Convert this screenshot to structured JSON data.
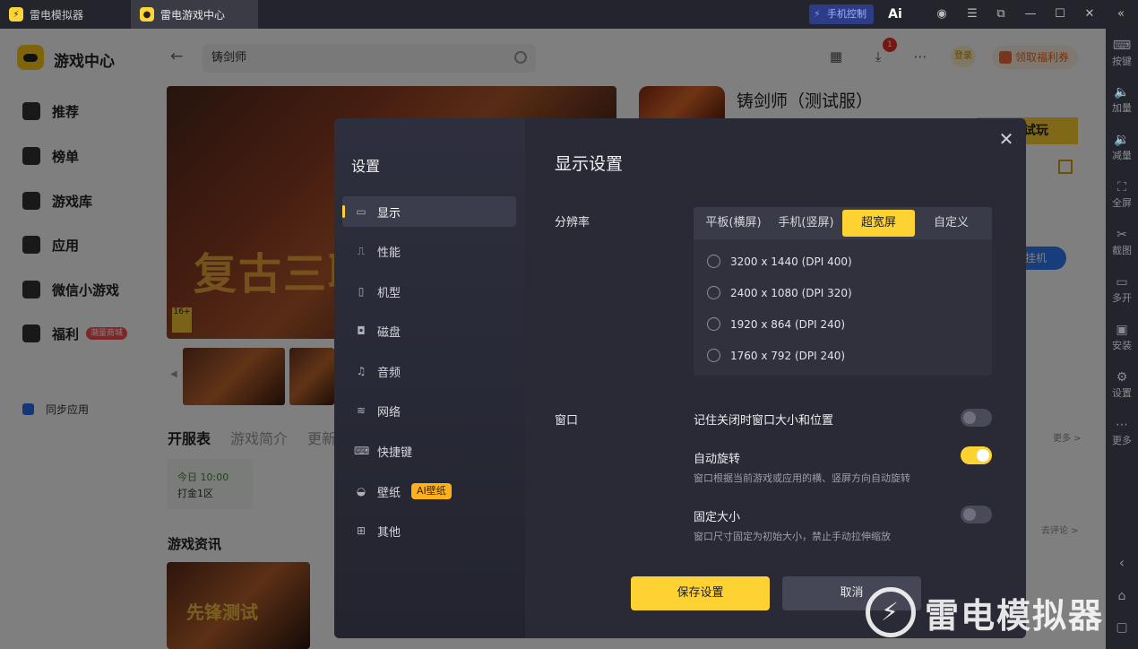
{
  "titlebar": {
    "tabs": [
      {
        "label": "雷电模拟器"
      },
      {
        "label": "雷电游戏中心"
      }
    ],
    "phone_control": "手机控制",
    "ai_label": "Ai"
  },
  "right_sidebar": {
    "items": [
      {
        "label": "按键",
        "icon": "keyboard-icon"
      },
      {
        "label": "加量",
        "icon": "volume-up-icon"
      },
      {
        "label": "减量",
        "icon": "volume-down-icon"
      },
      {
        "label": "全屏",
        "icon": "fullscreen-icon"
      },
      {
        "label": "截图",
        "icon": "screenshot-icon"
      },
      {
        "label": "多开",
        "icon": "multi-open-icon"
      },
      {
        "label": "安装",
        "icon": "install-icon"
      },
      {
        "label": "设置",
        "icon": "settings-icon"
      },
      {
        "label": "更多",
        "icon": "more-icon"
      }
    ]
  },
  "header": {
    "title": "游戏中心",
    "search_value": "铸剑师",
    "download_badge": "1",
    "login_label": "登录",
    "welfare_label": "领取福利券"
  },
  "nav": {
    "items": [
      {
        "label": "推荐"
      },
      {
        "label": "榜单"
      },
      {
        "label": "游戏库"
      },
      {
        "label": "应用"
      },
      {
        "label": "微信小游戏"
      },
      {
        "label": "福利"
      }
    ],
    "mall_badge": "潮量商城",
    "sync_label": "同步应用"
  },
  "background": {
    "banner_text": "复古三职",
    "age_rating": "16+",
    "tabs": [
      "开服表",
      "游戏简介",
      "更新"
    ],
    "server_time": "今日 10:00",
    "server_name": "打金1区",
    "news_title": "游戏资讯",
    "news_image_text": "先锋测试",
    "game_title": "铸剑师（测试服）",
    "try_label": "试玩",
    "blue_button": "挂机",
    "more_link": "更多 >",
    "comment_link": "去评论 >"
  },
  "dialog": {
    "sidebar_title": "设置",
    "menu": [
      {
        "label": "显示",
        "icon": "monitor-icon",
        "active": true
      },
      {
        "label": "性能",
        "icon": "performance-icon"
      },
      {
        "label": "机型",
        "icon": "phone-model-icon"
      },
      {
        "label": "磁盘",
        "icon": "disk-icon"
      },
      {
        "label": "音频",
        "icon": "audio-icon"
      },
      {
        "label": "网络",
        "icon": "wifi-icon"
      },
      {
        "label": "快捷键",
        "icon": "shortcut-keyboard-icon"
      },
      {
        "label": "壁纸",
        "icon": "wallpaper-icon"
      },
      {
        "label": "其他",
        "icon": "other-grid-icon"
      }
    ],
    "ai_wallpaper_badge": "AI壁纸",
    "title": "显示设置",
    "resolution_label": "分辨率",
    "resolution_tabs": [
      {
        "label": "平板(横屏)"
      },
      {
        "label": "手机(竖屏)"
      },
      {
        "label": "超宽屏",
        "selected": true
      },
      {
        "label": "自定义"
      }
    ],
    "resolution_options": [
      {
        "label": "3200 x 1440  (DPI 400)"
      },
      {
        "label": "2400 x 1080  (DPI 320)"
      },
      {
        "label": "1920 x 864  (DPI 240)"
      },
      {
        "label": "1760 x 792  (DPI 240)"
      }
    ],
    "window_label": "窗口",
    "window_options": [
      {
        "label": "记住关闭时窗口大小和位置",
        "desc": "",
        "on": false
      },
      {
        "label": "自动旋转",
        "desc": "窗口根据当前游戏或应用的横、竖屏方向自动旋转",
        "on": true
      },
      {
        "label": "固定大小",
        "desc": "窗口尺寸固定为初始大小，禁止手动拉伸缩放",
        "on": false
      }
    ],
    "save_label": "保存设置",
    "cancel_label": "取消"
  },
  "watermark": "雷电模拟器",
  "colors": {
    "accent": "#ffd233",
    "dialog_bg": "#2a2a36",
    "titlebar_bg": "#23242c"
  }
}
